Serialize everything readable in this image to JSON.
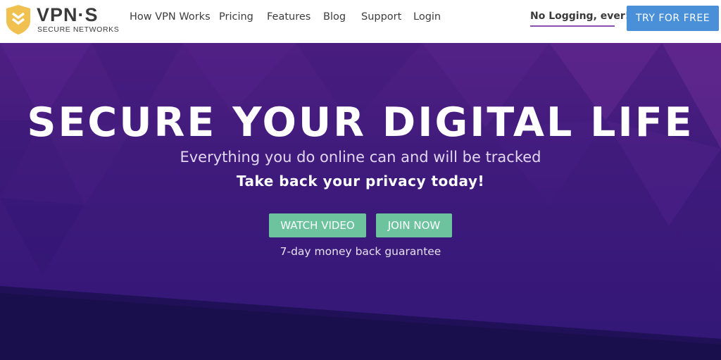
{
  "brand": {
    "name": "VPN·S",
    "tagline": "SECURE NETWORKS"
  },
  "nav": {
    "items": [
      {
        "label": "How VPN Works"
      },
      {
        "label": "Pricing"
      },
      {
        "label": "Features"
      },
      {
        "label": "Blog"
      },
      {
        "label": "Support"
      },
      {
        "label": "Login"
      }
    ],
    "no_logging": "No Logging, ever!",
    "cta": "TRY FOR FREE"
  },
  "hero": {
    "headline": "SECURE YOUR DIGITAL LIFE",
    "subheadline": "Everything you do online can and will be tracked",
    "emphasis": "Take back your privacy today!",
    "watch_video": "WATCH VIDEO",
    "join_now": "JOIN NOW",
    "guarantee": "7-day money back guarantee"
  },
  "colors": {
    "accent_blue": "#4a90d9",
    "accent_green": "#6cc39e",
    "hero_purple": "#401b7c",
    "logo_gold": "#f0c050",
    "underline": "#8a4fb0"
  },
  "icons": {
    "logo": "shield-chevron-icon"
  }
}
